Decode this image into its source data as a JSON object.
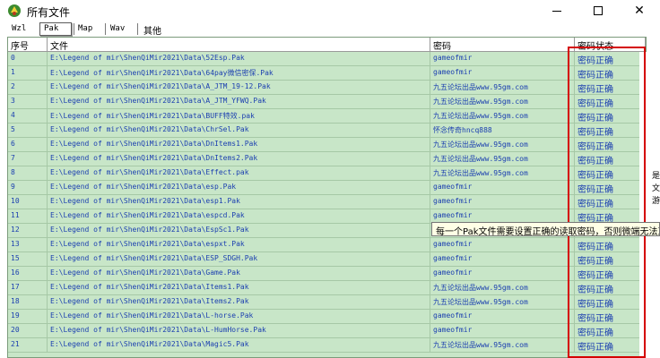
{
  "window": {
    "title": "所有文件",
    "minimize_label": "—",
    "close_label": "✕"
  },
  "tabs": [
    {
      "label": "Wzl",
      "active": false
    },
    {
      "label": "Pak",
      "active": true
    },
    {
      "label": "Map",
      "active": false
    },
    {
      "label": "Wav",
      "active": false
    },
    {
      "label": "其他",
      "active": false
    }
  ],
  "table": {
    "headers": [
      "序号",
      "文件",
      "密码",
      "密码状态"
    ],
    "rows": [
      {
        "idx": "0",
        "file": "E:\\Legend of mir\\ShenQiMir2021\\Data\\52Esp.Pak",
        "password": "gameofmir",
        "status": "密码正确"
      },
      {
        "idx": "1",
        "file": "E:\\Legend of mir\\ShenQiMir2021\\Data\\64pay微信密保.Pak",
        "password": "gameofmir",
        "status": "密码正确"
      },
      {
        "idx": "2",
        "file": "E:\\Legend of mir\\ShenQiMir2021\\Data\\A_JTM_19-12.Pak",
        "password": "九五论坛出品www.95gm.com",
        "status": "密码正确"
      },
      {
        "idx": "3",
        "file": "E:\\Legend of mir\\ShenQiMir2021\\Data\\A_JTM_YFWQ.Pak",
        "password": "九五论坛出品www.95gm.com",
        "status": "密码正确"
      },
      {
        "idx": "4",
        "file": "E:\\Legend of mir\\ShenQiMir2021\\Data\\BUFF特效.pak",
        "password": "九五论坛出品www.95gm.com",
        "status": "密码正确"
      },
      {
        "idx": "5",
        "file": "E:\\Legend of mir\\ShenQiMir2021\\Data\\ChrSel.Pak",
        "password": "怀念传奇hncq888",
        "status": "密码正确"
      },
      {
        "idx": "6",
        "file": "E:\\Legend of mir\\ShenQiMir2021\\Data\\DnItems1.Pak",
        "password": "九五论坛出品www.95gm.com",
        "status": "密码正确"
      },
      {
        "idx": "7",
        "file": "E:\\Legend of mir\\ShenQiMir2021\\Data\\DnItems2.Pak",
        "password": "九五论坛出品www.95gm.com",
        "status": "密码正确"
      },
      {
        "idx": "8",
        "file": "E:\\Legend of mir\\ShenQiMir2021\\Data\\Effect.pak",
        "password": "九五论坛出品www.95gm.com",
        "status": "密码正确"
      },
      {
        "idx": "9",
        "file": "E:\\Legend of mir\\ShenQiMir2021\\Data\\esp.Pak",
        "password": "gameofmir",
        "status": "密码正确"
      },
      {
        "idx": "10",
        "file": "E:\\Legend of mir\\ShenQiMir2021\\Data\\esp1.Pak",
        "password": "gameofmir",
        "status": "密码正确"
      },
      {
        "idx": "11",
        "file": "E:\\Legend of mir\\ShenQiMir2021\\Data\\espcd.Pak",
        "password": "gameofmir",
        "status": "密码正确"
      },
      {
        "idx": "12",
        "file": "E:\\Legend of mir\\ShenQiMir2021\\Data\\EspSc1.Pak",
        "password": "九五论坛出品www.95gm.com",
        "status": "密码正确"
      },
      {
        "idx": "13",
        "file": "E:\\Legend of mir\\ShenQiMir2021\\Data\\espxt.Pak",
        "password": "gameofmir",
        "status": "密码正确"
      },
      {
        "idx": "15",
        "file": "E:\\Legend of mir\\ShenQiMir2021\\Data\\ESP_SDGH.Pak",
        "password": "gameofmir",
        "status": "密码正确"
      },
      {
        "idx": "16",
        "file": "E:\\Legend of mir\\ShenQiMir2021\\Data\\Game.Pak",
        "password": "gameofmir",
        "status": "密码正确"
      },
      {
        "idx": "17",
        "file": "E:\\Legend of mir\\ShenQiMir2021\\Data\\Items1.Pak",
        "password": "九五论坛出品www.95gm.com",
        "status": "密码正确"
      },
      {
        "idx": "18",
        "file": "E:\\Legend of mir\\ShenQiMir2021\\Data\\Items2.Pak",
        "password": "九五论坛出品www.95gm.com",
        "status": "密码正确"
      },
      {
        "idx": "19",
        "file": "E:\\Legend of mir\\ShenQiMir2021\\Data\\L-horse.Pak",
        "password": "gameofmir",
        "status": "密码正确"
      },
      {
        "idx": "20",
        "file": "E:\\Legend of mir\\ShenQiMir2021\\Data\\L-HumHorse.Pak",
        "password": "gameofmir",
        "status": "密码正确"
      },
      {
        "idx": "21",
        "file": "E:\\Legend of mir\\ShenQiMir2021\\Data\\Magic5.Pak",
        "password": "九五论坛出品www.95gm.com",
        "status": "密码正确"
      }
    ]
  },
  "tooltip": {
    "text": "每一个Pak文件需要设置正确的读取密码，否则微端无法正常读"
  },
  "right_edge_text": "是\n文\n游"
}
